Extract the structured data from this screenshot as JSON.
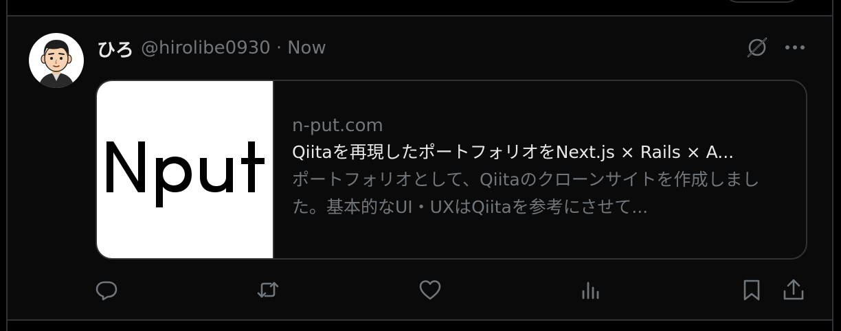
{
  "post": {
    "author": {
      "display_name": "ひろ",
      "handle": "@hirolibe0930",
      "separator": "·",
      "timestamp": "Now",
      "avatar_icon": "cartoon-man-avatar"
    },
    "header_actions": {
      "grok_icon": "grok-icon",
      "more_icon": "more-horizontal-icon"
    },
    "link_card": {
      "thumbnail_text": "Nput",
      "domain": "n-put.com",
      "title": "Qiitaを再現したポートフォリオをNext.js × Rails × A...",
      "description": "ポートフォリオとして、Qiitaのクローンサイトを作成しました。基本的なUI・UXはQiitaを参考にさせて..."
    },
    "actions": [
      {
        "name": "reply",
        "icon": "reply-icon"
      },
      {
        "name": "repost",
        "icon": "repost-icon"
      },
      {
        "name": "like",
        "icon": "heart-icon"
      },
      {
        "name": "views",
        "icon": "analytics-icon"
      },
      {
        "name": "bookmark",
        "icon": "bookmark-icon"
      },
      {
        "name": "share",
        "icon": "share-icon"
      }
    ]
  },
  "colors": {
    "background": "#000000",
    "primary_text": "#e7e9ea",
    "secondary_text": "#71767b",
    "border": "#2f3336",
    "icon": "#71767b"
  }
}
